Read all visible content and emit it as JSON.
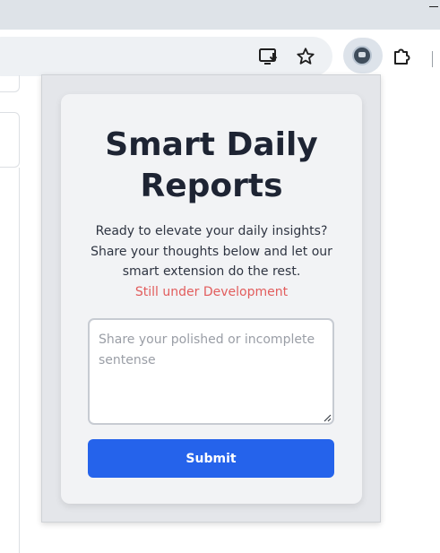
{
  "browser": {
    "toolbar_icons": {
      "install": "install-app-icon",
      "bookmark": "bookmark-star-icon",
      "extension": "extension-avatar-icon",
      "puzzle": "extensions-puzzle-icon"
    }
  },
  "popup": {
    "title": "Smart Daily Reports",
    "description": "Ready to elevate your daily insights? Share your thoughts below and let our smart extension do the rest.",
    "dev_note": "Still under Development",
    "input": {
      "value": "",
      "placeholder": "Share your polished or incomplete sentense"
    },
    "submit_label": "Submit",
    "colors": {
      "accent": "#2563eb",
      "warning": "#e25d5d",
      "title": "#1e2433"
    }
  }
}
